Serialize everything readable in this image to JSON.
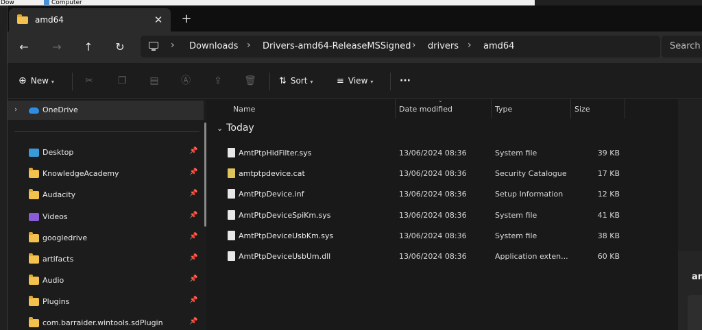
{
  "background": {
    "left_text": "Dow",
    "computer_label": "Computer"
  },
  "tab": {
    "title": "amd64",
    "close": "✕",
    "new": "+"
  },
  "nav": {
    "back": "←",
    "forward": "→",
    "up": "↑",
    "refresh": "↻"
  },
  "breadcrumbs": [
    "Downloads",
    "Drivers-amd64-ReleaseMSSigned",
    "drivers",
    "amd64"
  ],
  "search": {
    "placeholder": "Search a"
  },
  "toolbar": {
    "new_label": "New",
    "sort_label": "Sort",
    "view_label": "View",
    "more_label": "···"
  },
  "sidebar": {
    "items": [
      {
        "label": "OneDrive",
        "icon": "onedrive-icon"
      },
      {
        "label": "Desktop",
        "icon": "desktop-icon"
      },
      {
        "label": "KnowledgeAcademy",
        "icon": "folder-icon"
      },
      {
        "label": "Audacity",
        "icon": "folder-icon"
      },
      {
        "label": "Videos",
        "icon": "videos-icon"
      },
      {
        "label": "googledrive",
        "icon": "folder-icon"
      },
      {
        "label": "artifacts",
        "icon": "folder-icon"
      },
      {
        "label": "Audio",
        "icon": "folder-icon"
      },
      {
        "label": "Plugins",
        "icon": "folder-icon"
      },
      {
        "label": "com.barraider.wintools.sdPlugin",
        "icon": "folder-icon"
      }
    ]
  },
  "columns": {
    "name": "Name",
    "date": "Date modified",
    "type": "Type",
    "size": "Size"
  },
  "group": {
    "label": "Today"
  },
  "files": [
    {
      "name": "AmtPtpHidFilter.sys",
      "date": "13/06/2024 08:36",
      "type": "System file",
      "size": "39 KB"
    },
    {
      "name": "amtptpdevice.cat",
      "date": "13/06/2024 08:36",
      "type": "Security Catalogue",
      "size": "17 KB"
    },
    {
      "name": "AmtPtpDevice.inf",
      "date": "13/06/2024 08:36",
      "type": "Setup Information",
      "size": "12 KB"
    },
    {
      "name": "AmtPtpDeviceSpiKm.sys",
      "date": "13/06/2024 08:36",
      "type": "System file",
      "size": "41 KB"
    },
    {
      "name": "AmtPtpDeviceUsbKm.sys",
      "date": "13/06/2024 08:36",
      "type": "System file",
      "size": "38 KB"
    },
    {
      "name": "AmtPtpDeviceUsbUm.dll",
      "date": "13/06/2024 08:36",
      "type": "Application exten...",
      "size": "60 KB"
    }
  ],
  "details_pane": {
    "title": "an"
  }
}
